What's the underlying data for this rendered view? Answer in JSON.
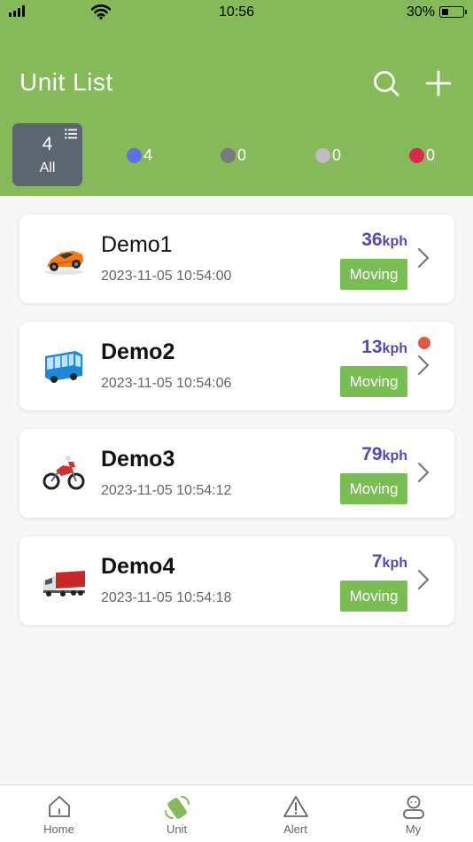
{
  "status_bar": {
    "time": "10:56",
    "battery": "30%"
  },
  "header": {
    "title": "Unit List"
  },
  "filters": {
    "all": {
      "count": "4",
      "label": "All"
    },
    "statuses": [
      {
        "color": "#6070e8",
        "count": "4"
      },
      {
        "color": "#7a7a7a",
        "count": "0"
      },
      {
        "color": "#bdbdbd",
        "count": "0"
      },
      {
        "color": "#d82a4e",
        "count": "0"
      }
    ]
  },
  "units": [
    {
      "name": "Demo1",
      "time": "2023-11-05 10:54:00",
      "speed": "36",
      "speed_unit": "kph",
      "status": "Moving",
      "icon": "car-icon",
      "alert": false
    },
    {
      "name": "Demo2",
      "time": "2023-11-05 10:54:06",
      "speed": "13",
      "speed_unit": "kph",
      "status": "Moving",
      "icon": "bus-icon",
      "alert": true
    },
    {
      "name": "Demo3",
      "time": "2023-11-05 10:54:12",
      "speed": "79",
      "speed_unit": "kph",
      "status": "Moving",
      "icon": "motorcycle-icon",
      "alert": false
    },
    {
      "name": "Demo4",
      "time": "2023-11-05 10:54:18",
      "speed": "7",
      "speed_unit": "kph",
      "status": "Moving",
      "icon": "truck-icon",
      "alert": false
    }
  ],
  "tabbar": {
    "tabs": [
      {
        "label": "Home",
        "icon": "home-icon"
      },
      {
        "label": "Unit",
        "icon": "unit-icon"
      },
      {
        "label": "Alert",
        "icon": "alert-icon"
      },
      {
        "label": "My",
        "icon": "profile-icon"
      }
    ],
    "active": "Unit"
  },
  "colors": {
    "header": "#85b95a",
    "speed": "#5a45b5",
    "badge": "#79be52",
    "active_tab": "#85b95a",
    "alert_dot": "#e05a45"
  }
}
